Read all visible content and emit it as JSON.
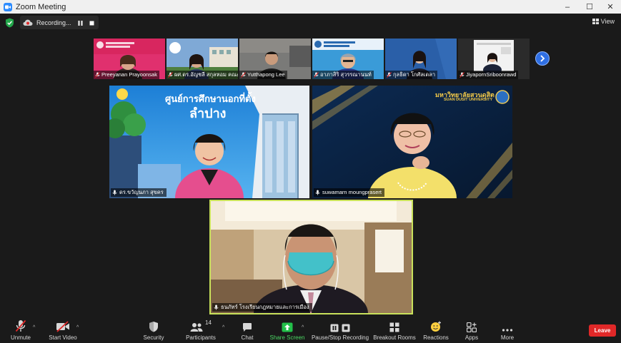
{
  "window": {
    "title": "Zoom Meeting",
    "controls": [
      "–",
      "☐",
      "✕"
    ]
  },
  "recording": {
    "label": "Recording..."
  },
  "view": {
    "label": "View"
  },
  "thumbnails": [
    {
      "name": "Preeyanan Prayoonsak",
      "bg": "#e0306e"
    },
    {
      "name": "ผศ.ดร.อัญชลี สกุลหอม คณะ...",
      "bg": "#5a8fbf"
    },
    {
      "name": "Yutthapong Lee",
      "bg": "#6b6b6b"
    },
    {
      "name": "อาภาสิริ สุวรรณานนท์",
      "bg": "#3a9bd8"
    },
    {
      "name": "กุลธิดา โกศัลเดลา",
      "bg": "#2a5fa8"
    },
    {
      "name": "JiyapornSriboonrawd",
      "bg": "#2b2b2b"
    }
  ],
  "tiles": {
    "top_left": {
      "name": "ดร.ขวัญนภา สุขคร",
      "banner_line1": "ศูนย์การศึกษานอกที่ตั้ง",
      "banner_line2": "ลำปาง"
    },
    "top_right": {
      "name": "suwamarn moungprasert",
      "logo_thai": "มหาวิทยาลัยสวนดุสิต",
      "logo_eng": "SUAN DUSIT UNIVERSITY"
    },
    "speaker": {
      "name": "ธนภัทร์ โรงเรียนกฎหมายและการเมือง"
    }
  },
  "toolbar": {
    "unmute": "Unmute",
    "start_video": "Start Video",
    "security": "Security",
    "participants": "Participants",
    "participants_count": "14",
    "chat": "Chat",
    "share_screen": "Share Screen",
    "pause_stop": "Pause/Stop Recording",
    "breakout": "Breakout Rooms",
    "reactions": "Reactions",
    "apps": "Apps",
    "more": "More",
    "leave": "Leave"
  },
  "colors": {
    "accent_blue": "#2d8cff",
    "leave_red": "#e02828",
    "share_green": "#4cd964",
    "speaker_border": "#c9e25b",
    "security_green": "#23a74a"
  }
}
